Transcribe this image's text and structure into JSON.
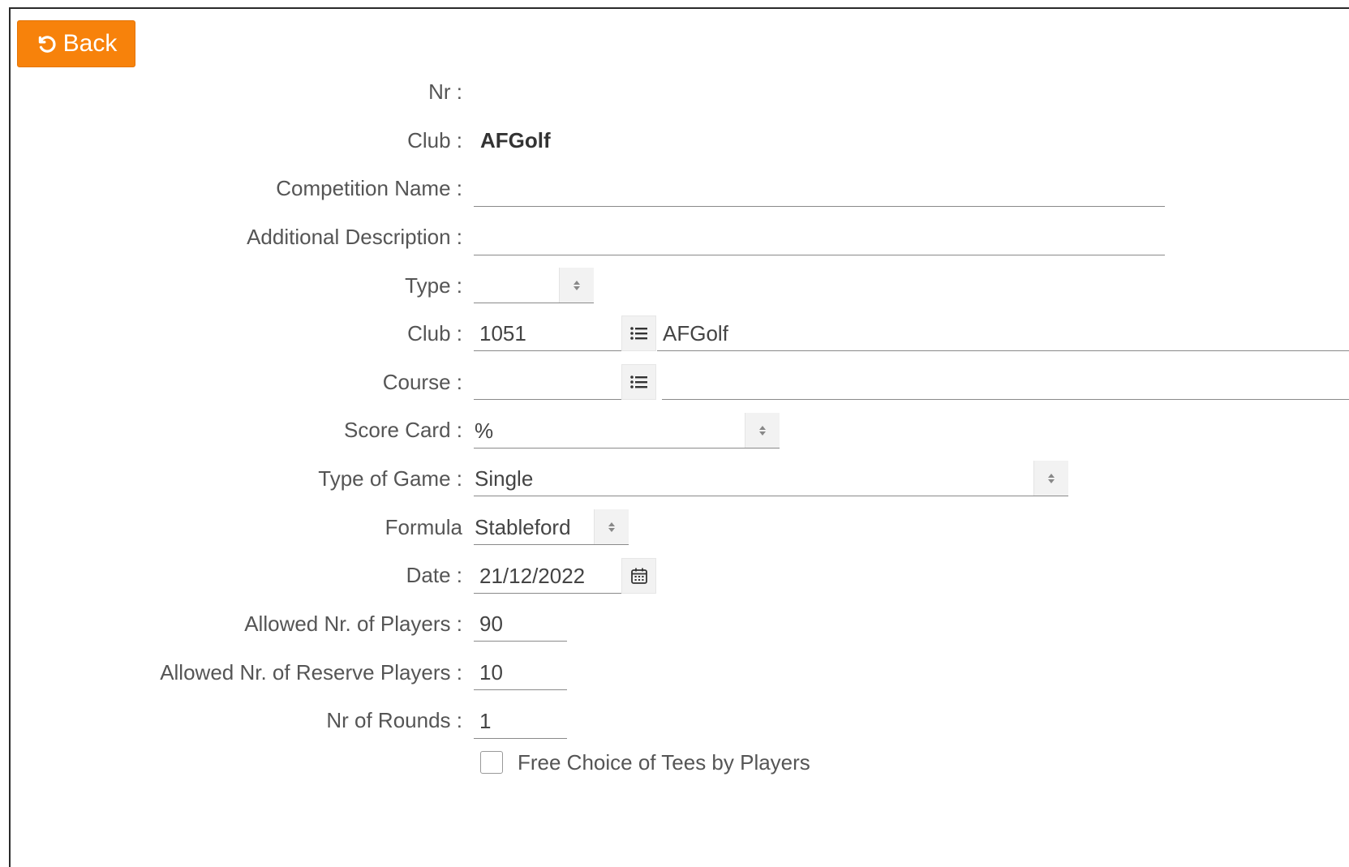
{
  "toolbar": {
    "back_label": "Back"
  },
  "form": {
    "nr": {
      "label": "Nr :"
    },
    "club_static": {
      "label": "Club :",
      "value": "AFGolf"
    },
    "competition_name": {
      "label": "Competition Name :",
      "value": ""
    },
    "additional_description": {
      "label": "Additional Description :",
      "value": ""
    },
    "type": {
      "label": "Type :",
      "value": ""
    },
    "club": {
      "label": "Club :",
      "code": "1051",
      "name": "AFGolf"
    },
    "course": {
      "label": "Course :",
      "code": "",
      "name": ""
    },
    "score_card": {
      "label": "Score Card :",
      "value": "%"
    },
    "type_of_game": {
      "label": "Type of Game :",
      "value": "Single"
    },
    "formula": {
      "label": "Formula",
      "value": "Stableford"
    },
    "date": {
      "label": "Date :",
      "value": "21/12/2022"
    },
    "allowed_players": {
      "label": "Allowed Nr. of Players :",
      "value": "90"
    },
    "allowed_reserve": {
      "label": "Allowed Nr. of Reserve Players :",
      "value": "10"
    },
    "nr_rounds": {
      "label": "Nr of Rounds :",
      "value": "1"
    },
    "free_choice_tees": {
      "label": "Free Choice of Tees by Players",
      "checked": false
    }
  },
  "colors": {
    "accent": "#f7820b"
  }
}
